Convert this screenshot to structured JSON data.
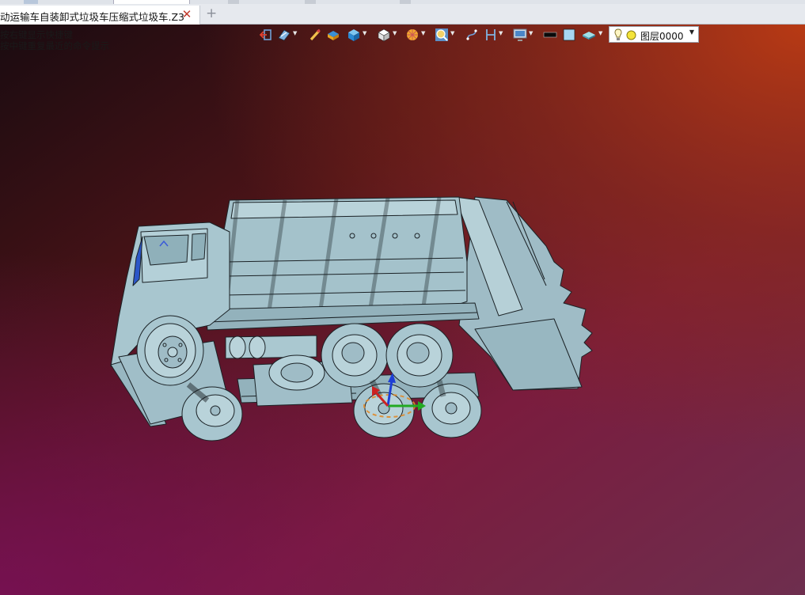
{
  "tab": {
    "title": "动运输车自装卸式垃圾车压缩式垃圾车.Z3",
    "close_glyph": "✕",
    "new_tab_glyph": "+"
  },
  "viewport": {
    "hints": [
      "按右键显示快捷键",
      "按中键重复最近的命令提示"
    ],
    "background_colors": [
      "#1a0b10",
      "#5a1418",
      "#8a2a1a",
      "#6a1550",
      "#7a3a52"
    ]
  },
  "toolbar": {
    "icons": [
      "exit-icon",
      "view-style-icon",
      "pen-icon",
      "display-mode-icon",
      "shaded-cube-icon",
      "view-cube-icon",
      "render-icon",
      "zoom-icon",
      "sketch-icon",
      "section-icon",
      "filter-icon",
      "line-color-icon",
      "fill-color-icon",
      "material-icon",
      "lightbulb-icon",
      "layer-color-icon"
    ],
    "layer": "图层0000"
  },
  "model": {
    "name": "compactor-garbage-truck",
    "color": "#a8c6cf",
    "edge_color": "#1b2226"
  },
  "triad": {
    "x_color": "#22aa22",
    "y_color": "#1e3fd6",
    "z_color": "#cc2222",
    "ring_color": "#e08a2a"
  }
}
